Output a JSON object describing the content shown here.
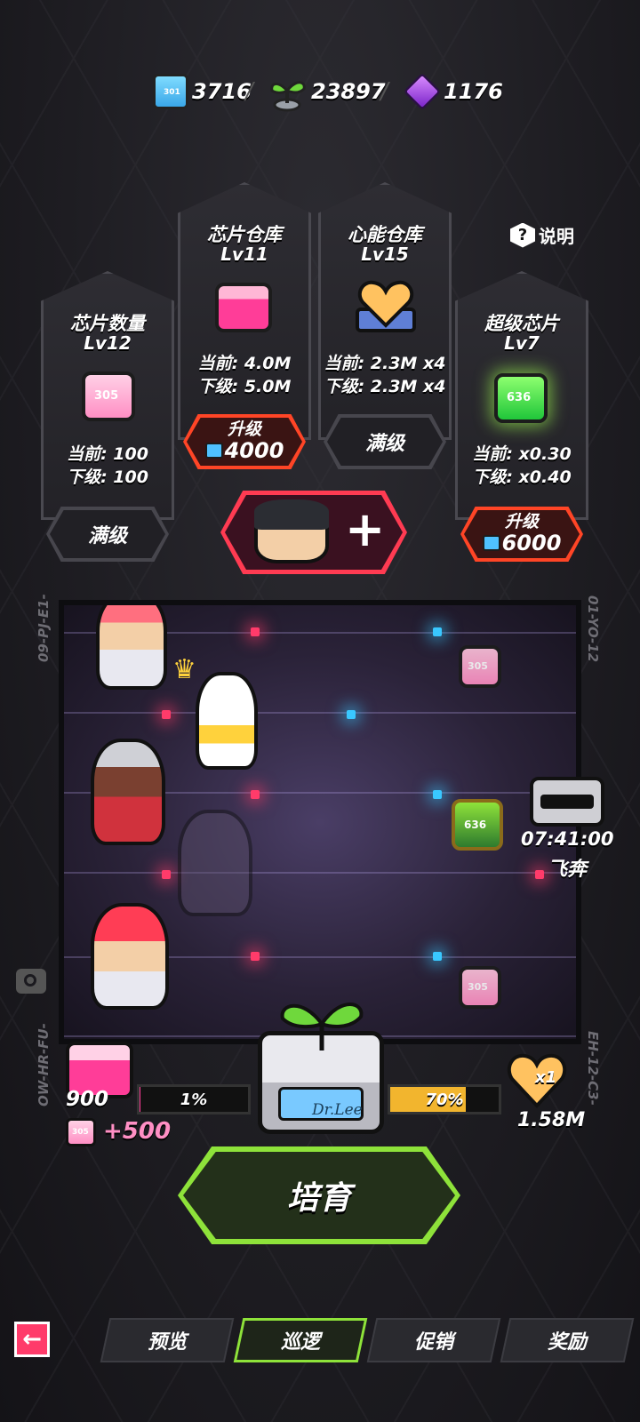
{
  "resources": {
    "chip_count": "3716",
    "sprout_count": "23897",
    "gem_count": "1176"
  },
  "help": {
    "label": "说明"
  },
  "cards": {
    "chip_quantity": {
      "title": "芯片数量",
      "level": "Lv12",
      "icon_code": "305",
      "current": "当前: 100",
      "next": "下级: 100",
      "button": "满级"
    },
    "chip_storage": {
      "title": "芯片仓库",
      "level": "Lv11",
      "current": "当前: 4.0M",
      "next": "下级: 5.0M",
      "button_label": "升级",
      "button_cost": "4000"
    },
    "heart_storage": {
      "title": "心能仓库",
      "level": "Lv15",
      "current": "当前: 2.3M x4",
      "next": "下级: 2.3M x4",
      "button": "满级"
    },
    "super_chip": {
      "title": "超级芯片",
      "level": "Lv7",
      "icon_code": "636",
      "current": "当前: x0.30",
      "next": "下级: x0.40",
      "button_label": "升级",
      "button_cost": "6000"
    }
  },
  "arena": {
    "left_code": "09-PJ-E1-",
    "right_code": "01-YO-12",
    "chip_code_top": "305",
    "chip_code_mid": "636",
    "chip_code_bottom": "305",
    "timer": "07:41:00",
    "timer_label": "飞奔",
    "left_bottom_code": "OW-HR-FU-",
    "right_bottom_code": "EH-12-C3-"
  },
  "bottom": {
    "storage_count": "900",
    "chip_bonus": "+500",
    "chip_bonus_code": "305",
    "left_progress": "1%",
    "left_progress_value": 0.01,
    "right_progress": "70%",
    "right_progress_value": 0.7,
    "machine_label": "Dr.Lee",
    "heart_multiplier": "x1",
    "heart_amount": "1.58M",
    "action_button": "培育"
  },
  "nav": {
    "tabs": [
      "预览",
      "巡逻",
      "促销",
      "奖励"
    ],
    "active_index": 1
  },
  "colors": {
    "accent_green": "#8ee23a",
    "accent_red": "#ff4526",
    "chip_pink": "#ff8fc4",
    "chip_green": "#4be04b"
  }
}
